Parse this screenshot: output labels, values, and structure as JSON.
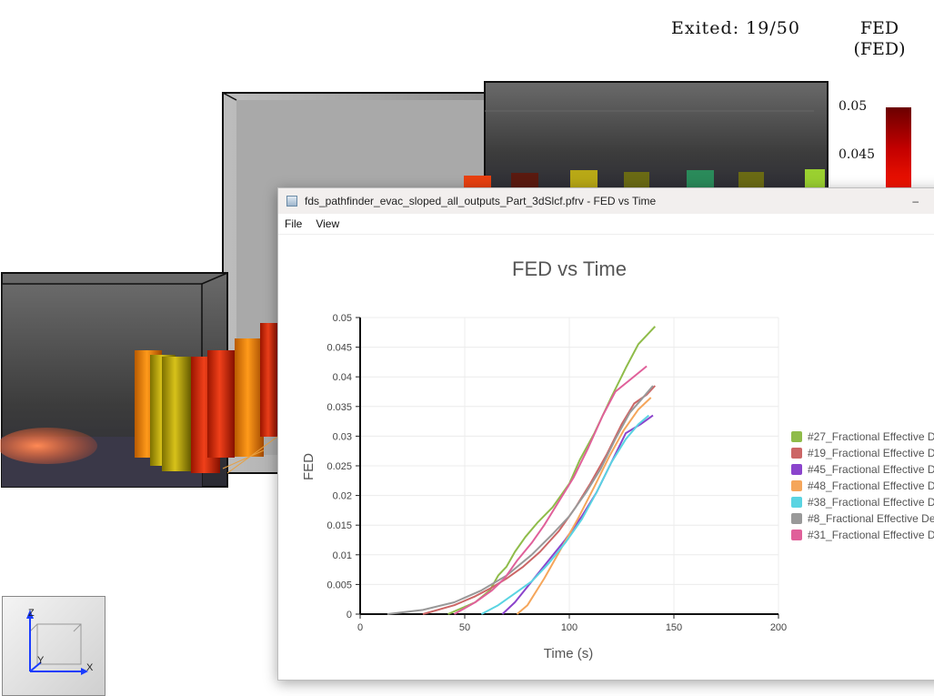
{
  "hud": {
    "exited_label": "Exited:",
    "exited_value": "19/50",
    "colorbar_title_line1": "FED",
    "colorbar_title_line2": "(FED)",
    "colorbar_ticks": [
      "0.05",
      "0.045"
    ],
    "axes_labels": {
      "z": "Z",
      "y": "Y",
      "x": "X"
    }
  },
  "window": {
    "title": "fds_pathfinder_evac_sloped_all_outputs_Part_3dSlcf.pfrv - FED vs Time",
    "menu": [
      "File",
      "View"
    ]
  },
  "chart_data": {
    "type": "line",
    "title": "FED vs Time",
    "xlabel": "Time (s)",
    "ylabel": "FED",
    "xlim": [
      0,
      200
    ],
    "ylim": [
      0,
      0.05
    ],
    "xticks": [
      0,
      50,
      100,
      150,
      200
    ],
    "yticks": [
      0,
      0.005,
      0.01,
      0.015,
      0.02,
      0.025,
      0.03,
      0.035,
      0.04,
      0.045,
      0.05
    ],
    "grid": true,
    "legend_position": "right",
    "series": [
      {
        "name": "#27_Fractional Effective D",
        "color": "#8fbc4a",
        "x": [
          42,
          55,
          62,
          66,
          70,
          74,
          79,
          85,
          92,
          100,
          105,
          112,
          120,
          127,
          133,
          141
        ],
        "y": [
          0,
          0.002,
          0.004,
          0.0065,
          0.008,
          0.0105,
          0.013,
          0.0155,
          0.018,
          0.022,
          0.026,
          0.0305,
          0.0365,
          0.0415,
          0.0455,
          0.0485
        ]
      },
      {
        "name": "#19_Fractional Effective D",
        "color": "#cc6666",
        "x": [
          30,
          45,
          55,
          63,
          70,
          78,
          86,
          95,
          103,
          110,
          118,
          125,
          131,
          137,
          141
        ],
        "y": [
          0,
          0.0015,
          0.003,
          0.0045,
          0.006,
          0.008,
          0.0105,
          0.014,
          0.018,
          0.022,
          0.027,
          0.032,
          0.0355,
          0.037,
          0.0385
        ]
      },
      {
        "name": "#45_Fractional Effective D",
        "color": "#8b44cc",
        "x": [
          68,
          74,
          82,
          90,
          98,
          106,
          113,
          120,
          127,
          134,
          140
        ],
        "y": [
          0,
          0.002,
          0.0055,
          0.009,
          0.0125,
          0.0165,
          0.0205,
          0.0255,
          0.0305,
          0.032,
          0.0335
        ]
      },
      {
        "name": "#48_Fractional Effective D",
        "color": "#f5a65b",
        "x": [
          75,
          80,
          88,
          96,
          104,
          112,
          119,
          126,
          133,
          139
        ],
        "y": [
          0,
          0.0015,
          0.006,
          0.011,
          0.016,
          0.0215,
          0.0265,
          0.031,
          0.0345,
          0.0365
        ]
      },
      {
        "name": "#38_Fractional Effective D",
        "color": "#5ad4e2",
        "x": [
          58,
          66,
          74,
          82,
          90,
          98,
          106,
          113,
          120,
          127,
          133,
          138
        ],
        "y": [
          0,
          0.0015,
          0.0035,
          0.0055,
          0.0085,
          0.012,
          0.016,
          0.0205,
          0.0255,
          0.0295,
          0.032,
          0.0335
        ]
      },
      {
        "name": "#8_Fractional Effective De",
        "color": "#999999",
        "x": [
          13,
          30,
          45,
          58,
          70,
          82,
          92,
          100,
          108,
          115,
          122,
          129,
          134,
          140
        ],
        "y": [
          0,
          0.0007,
          0.002,
          0.004,
          0.0065,
          0.01,
          0.0135,
          0.0165,
          0.0205,
          0.0245,
          0.0295,
          0.034,
          0.036,
          0.0385
        ]
      },
      {
        "name": "#31_Fractional Effective D",
        "color": "#e0609a",
        "x": [
          45,
          55,
          63,
          69,
          75,
          82,
          88,
          95,
          102,
          109,
          116,
          122,
          129,
          137
        ],
        "y": [
          0,
          0.002,
          0.004,
          0.006,
          0.009,
          0.012,
          0.015,
          0.019,
          0.023,
          0.028,
          0.0335,
          0.0375,
          0.0395,
          0.0418
        ]
      }
    ]
  }
}
